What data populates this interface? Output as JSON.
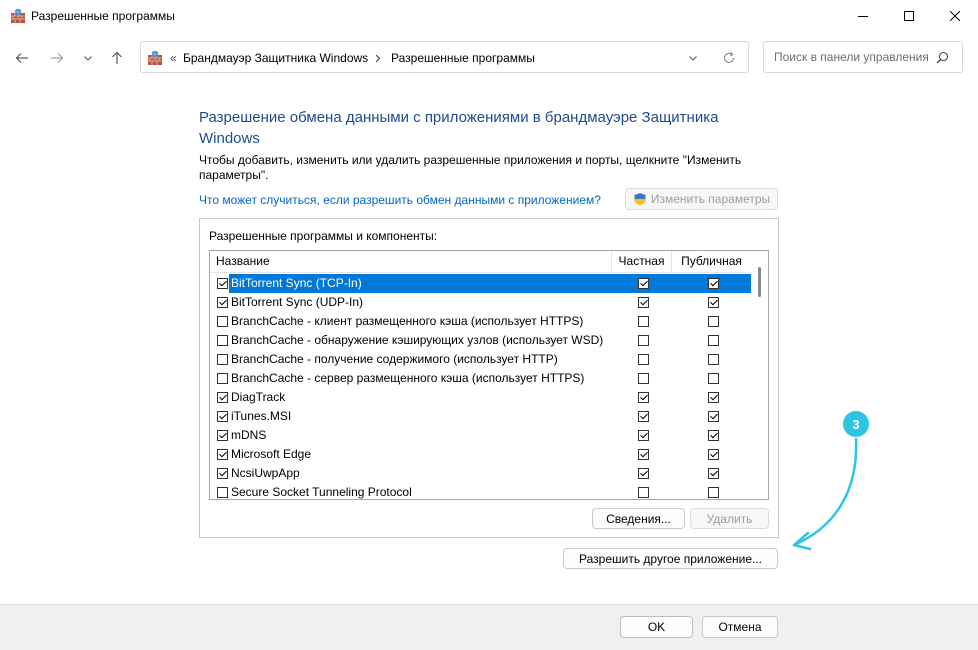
{
  "window": {
    "title": "Разрешенные программы",
    "colors": {
      "accent": "#0078d7",
      "heading": "#1e4b8f",
      "link": "#0066cc",
      "annotation": "#2ec4e6"
    }
  },
  "nav": {
    "breadcrumb_sep": "«",
    "crumbs": [
      "Брандмауэр Защитника Windows",
      "Разрешенные программы"
    ],
    "search_placeholder": "Поиск в панели управления"
  },
  "content": {
    "heading": "Разрешение обмена данными с приложениями в брандмауэре Защитника Windows",
    "description": "Чтобы добавить, изменить или удалить разрешенные приложения и порты, щелкните \"Изменить параметры\".",
    "risk_link": "Что может случиться, если разрешить обмен данными с приложением?",
    "change_settings_label": "Изменить параметры",
    "group_label": "Разрешенные программы и компоненты:",
    "columns": {
      "name": "Название",
      "private": "Частная",
      "public": "Публичная"
    },
    "rows": [
      {
        "name": "BitTorrent Sync (TCP-In)",
        "enabled": true,
        "private": true,
        "public": true,
        "selected": true
      },
      {
        "name": "BitTorrent Sync (UDP-In)",
        "enabled": true,
        "private": true,
        "public": true
      },
      {
        "name": "BranchCache - клиент размещенного кэша (использует HTTPS)",
        "enabled": false,
        "private": false,
        "public": false
      },
      {
        "name": "BranchCache - обнаружение кэширующих узлов (использует WSD)",
        "enabled": false,
        "private": false,
        "public": false
      },
      {
        "name": "BranchCache - получение содержимого (использует HTTP)",
        "enabled": false,
        "private": false,
        "public": false
      },
      {
        "name": "BranchCache - сервер размещенного кэша (использует HTTPS)",
        "enabled": false,
        "private": false,
        "public": false
      },
      {
        "name": "DiagTrack",
        "enabled": true,
        "private": true,
        "public": true
      },
      {
        "name": "iTunes.MSI",
        "enabled": true,
        "private": true,
        "public": true
      },
      {
        "name": "mDNS",
        "enabled": true,
        "private": true,
        "public": true
      },
      {
        "name": "Microsoft Edge",
        "enabled": true,
        "private": true,
        "public": true
      },
      {
        "name": "NcsiUwpApp",
        "enabled": true,
        "private": true,
        "public": true
      },
      {
        "name": "Secure Socket Tunneling Protocol",
        "enabled": false,
        "private": false,
        "public": false
      }
    ],
    "details_label": "Сведения...",
    "remove_label": "Удалить",
    "allow_other_label": "Разрешить другое приложение..."
  },
  "footer": {
    "ok_label": "OK",
    "cancel_label": "Отмена"
  },
  "annotation": {
    "badge": "3"
  }
}
